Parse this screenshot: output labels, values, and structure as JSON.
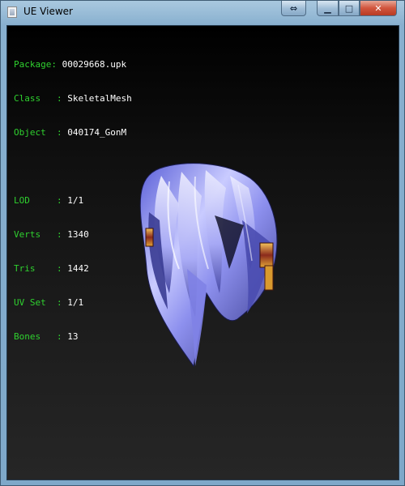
{
  "window": {
    "title": "UE Viewer",
    "restore_toggle_glyph": "⇔",
    "minimize_glyph": "▁",
    "maximize_glyph": "□",
    "close_glyph": "✕"
  },
  "info": {
    "group1": [
      {
        "label": "Package: ",
        "value": "00029668.upk"
      },
      {
        "label": "Class   : ",
        "value": "SkeletalMesh"
      },
      {
        "label": "Object  : ",
        "value": "040174_GonM"
      }
    ],
    "group2": [
      {
        "label": "LOD     : ",
        "value": "1/1"
      },
      {
        "label": "Verts   : ",
        "value": "1340"
      },
      {
        "label": "Tris    : ",
        "value": "1442"
      },
      {
        "label": "UV Set  : ",
        "value": "1/1"
      },
      {
        "label": "Bones   : ",
        "value": "13"
      }
    ]
  },
  "colors": {
    "label": "#2fd12f",
    "value": "#ffffff",
    "viewport_bg": "#000000",
    "hair_main": "#8c8ff0",
    "hair_highlight": "#f0f0ff",
    "hair_shadow": "#2a2c6a"
  }
}
